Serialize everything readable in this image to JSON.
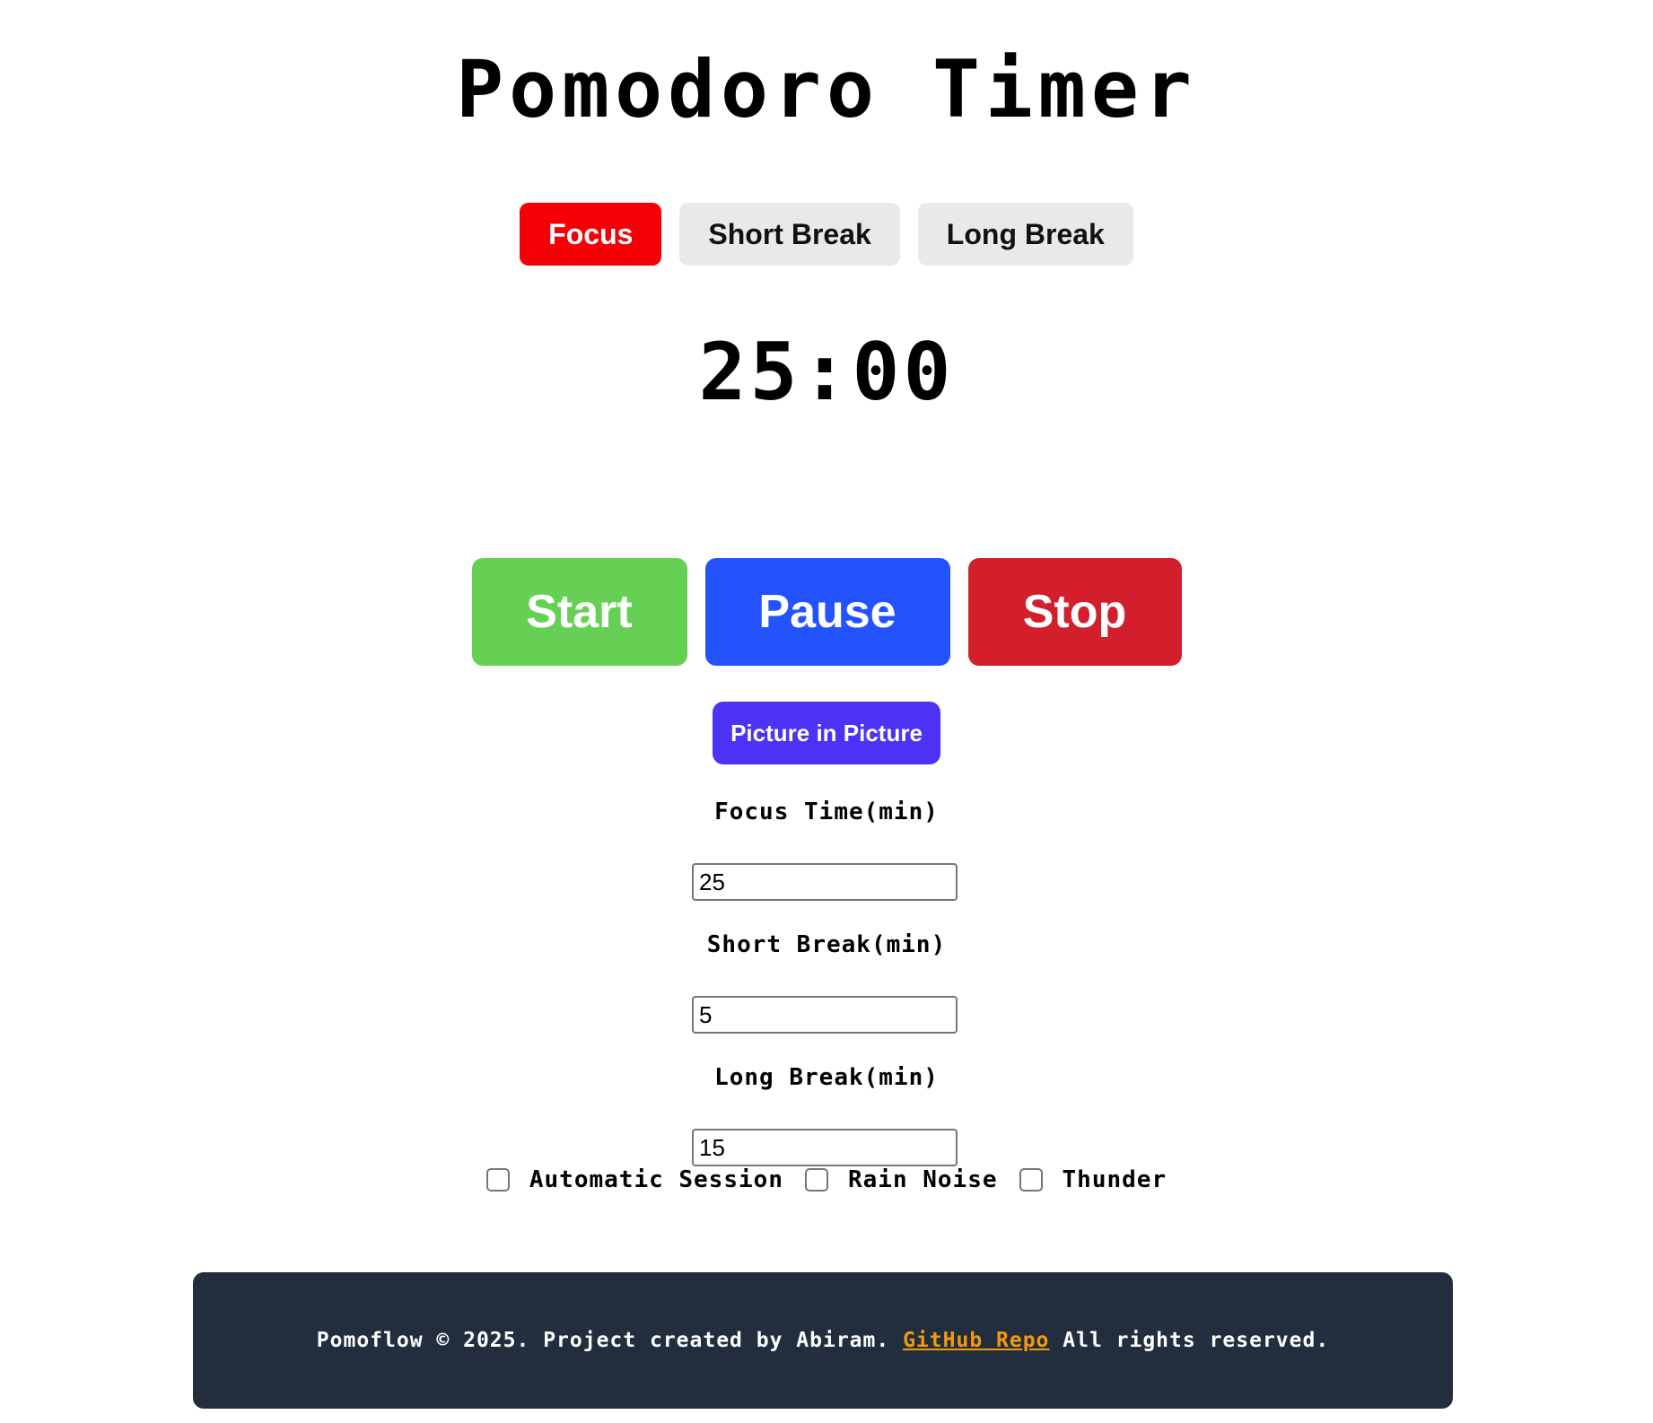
{
  "title": "Pomodoro Timer",
  "modes": [
    {
      "label": "Focus",
      "active": true
    },
    {
      "label": "Short Break",
      "active": false
    },
    {
      "label": "Long Break",
      "active": false
    }
  ],
  "timer": {
    "display": "25:00"
  },
  "controls": {
    "start_label": "Start",
    "pause_label": "Pause",
    "stop_label": "Stop"
  },
  "pip_label": "Picture in Picture",
  "settings": {
    "focus": {
      "label": "Focus Time(min)",
      "value": "25"
    },
    "short_break": {
      "label": "Short Break(min)",
      "value": "5"
    },
    "long_break": {
      "label": "Long Break(min)",
      "value": "15"
    }
  },
  "options": [
    {
      "label": "Automatic Session",
      "checked": false
    },
    {
      "label": "Rain Noise",
      "checked": false
    },
    {
      "label": "Thunder",
      "checked": false
    }
  ],
  "footer": {
    "prefix": "Pomoflow © 2025. Project created by Abiram. ",
    "link_text": "GitHub Repo",
    "suffix": " All rights reserved."
  },
  "colors": {
    "focus_active": "#f50006",
    "tab_inactive": "#e9e9e9",
    "start": "#66d055",
    "pause": "#2253fd",
    "stop": "#d21f2b",
    "pip": "#4b32f5",
    "footer_bg": "#222e3e",
    "footer_link": "#f29a0c"
  }
}
